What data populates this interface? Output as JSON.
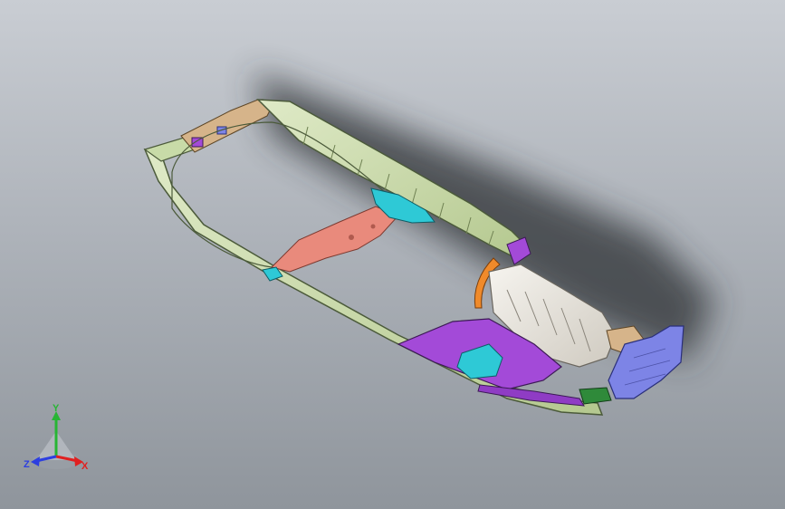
{
  "viewport": {
    "background_top": "#c9cdd3",
    "background_bottom": "#8f959c",
    "model": "car-body-floor-frame-assembly"
  },
  "colors": {
    "rail_green": "#c8dba8",
    "rail_outline": "#4b5a3a",
    "salmon_panel": "#e98a7c",
    "cyan_part": "#2ec9d6",
    "tan_part": "#d6b48a",
    "purple_part": "#a34ad8",
    "orange_part": "#f08a2a",
    "white_part": "#ece9e3",
    "blue_part": "#7d84e6",
    "dark_green_part": "#2f8a3a",
    "shadow": "#3a3d42"
  },
  "triad": {
    "x_label": "X",
    "y_label": "Y",
    "z_label": "Z",
    "x_color": "#e02020",
    "y_color": "#27b534",
    "z_color": "#2d3fe0"
  }
}
